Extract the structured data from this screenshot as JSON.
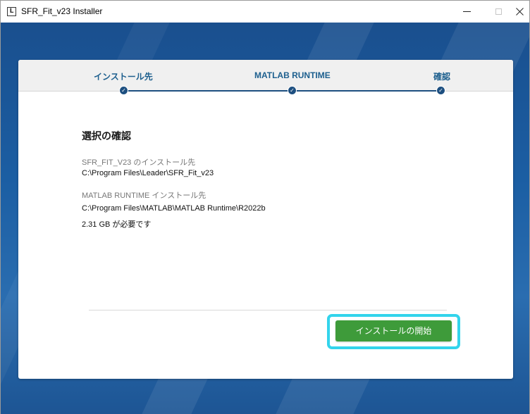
{
  "window": {
    "title": "SFR_Fit_v23 Installer",
    "icon_letter": "L"
  },
  "stepper": {
    "steps": [
      {
        "label": "インストール先",
        "state": "done"
      },
      {
        "label": "MATLAB RUNTIME",
        "state": "done"
      },
      {
        "label": "確認",
        "state": "current"
      }
    ]
  },
  "confirmation": {
    "title": "選択の確認",
    "app_install_caption": "SFR_FIT_V23 のインストール先",
    "app_install_path": "C:\\Program Files\\Leader\\SFR_Fit_v23",
    "runtime_caption": "MATLAB RUNTIME インストール先",
    "runtime_path": "C:\\Program Files\\MATLAB\\MATLAB Runtime\\R2022b",
    "space_required": "2.31 GB が必要です"
  },
  "actions": {
    "install_label": "インストールの開始"
  },
  "colors": {
    "accent_text": "#1d5f8e",
    "step_line": "#1d4f80",
    "install_button": "#3e9b3a",
    "highlight": "#33d4ec"
  }
}
